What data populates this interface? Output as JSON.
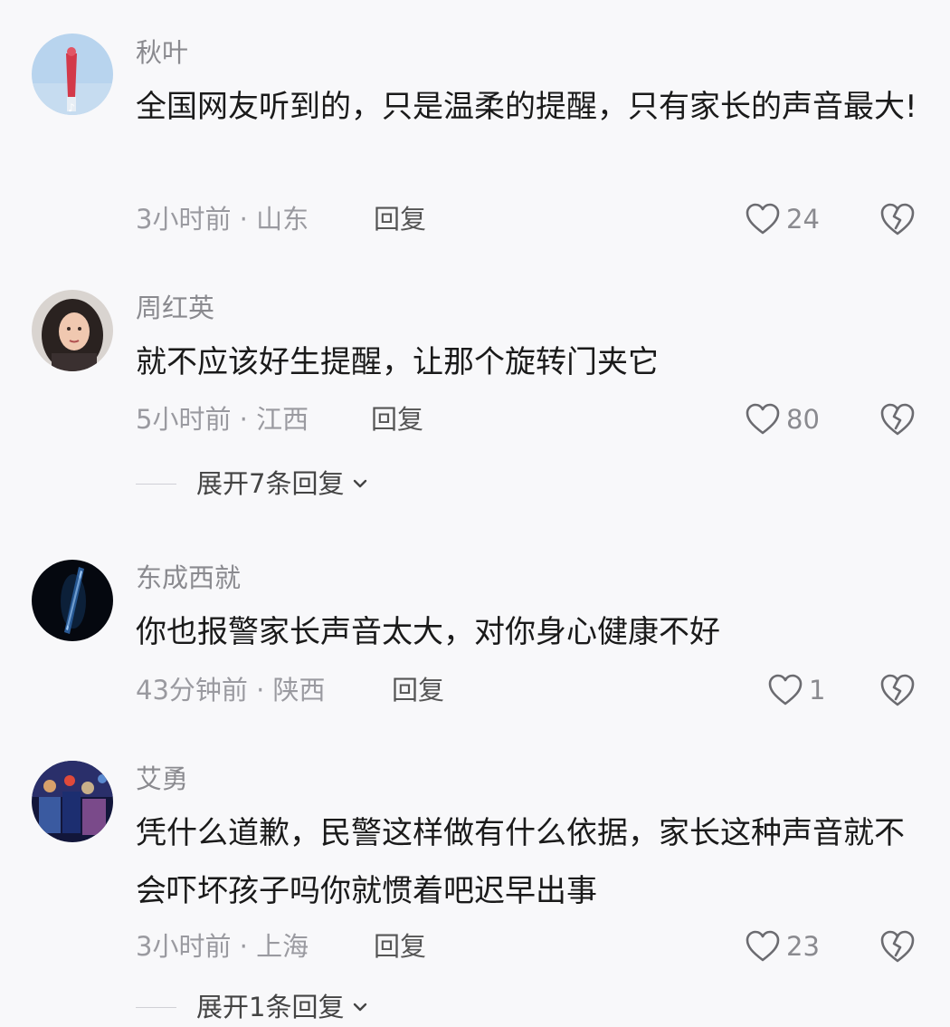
{
  "comments": [
    {
      "username": "秋叶",
      "text": "全国网友听到的，只是温柔的提醒，只有家长的声音最大!",
      "meta": "3小时前 · 山东",
      "reply_label": "回复",
      "likes": "24",
      "avatar": "tiktok-logo-avatar"
    },
    {
      "username": "周红英",
      "text": "就不应该好生提醒，让那个旋转门夹它",
      "meta": "5小时前 · 江西",
      "reply_label": "回复",
      "likes": "80",
      "expand_label": "展开7条回复",
      "avatar": "portrait-avatar"
    },
    {
      "username": "东成西就",
      "text": "你也报警家长声音太大，对你身心健康不好",
      "meta": "43分钟前 · 陕西",
      "reply_label": "回复",
      "likes": "1",
      "avatar": "blue-light-avatar"
    },
    {
      "username": "艾勇",
      "text": "凭什么道歉，民警这样做有什么依据，家长这种声音就不会吓坏孩子吗你就惯着吧迟早出事",
      "meta": "3小时前 · 上海",
      "reply_label": "回复",
      "likes": "23",
      "expand_label": "展开1条回复",
      "avatar": "crowd-scene-avatar"
    }
  ],
  "icons": {
    "like": "heart-outline-icon",
    "dislike": "broken-heart-icon",
    "expand": "chevron-down-icon"
  },
  "colors": {
    "background": "#f8f8fa",
    "text": "#1a1a1a",
    "secondary": "#8a8a8f"
  }
}
